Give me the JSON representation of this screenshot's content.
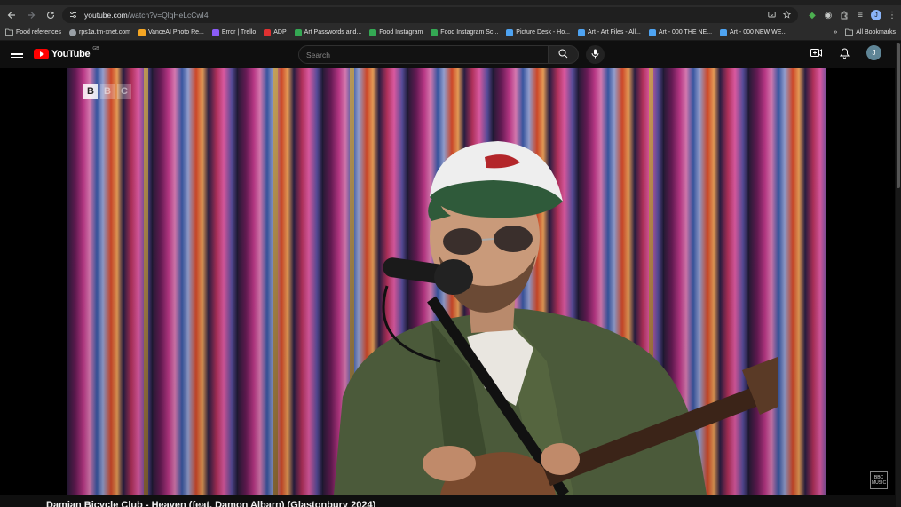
{
  "browser": {
    "url_host": "youtube.com",
    "url_path": "/watch?v=QlqHeLcCwI4",
    "bookmarks": [
      {
        "label": "Food references",
        "color": "#9aa0a6"
      },
      {
        "label": "rps1a.tm-xnet.com",
        "color": "#9aa0a6"
      },
      {
        "label": "VanceAI Photo Re...",
        "color": "#f5a623"
      },
      {
        "label": "Error | Trello",
        "color": "#8b5cf6"
      },
      {
        "label": "ADP",
        "color": "#e03131"
      },
      {
        "label": "Art Passwords and...",
        "color": "#34a853"
      },
      {
        "label": "Food Instagram",
        "color": "#34a853"
      },
      {
        "label": "Food Instagram Sc...",
        "color": "#34a853"
      },
      {
        "label": "Picture Desk - Ho...",
        "color": "#4ea3f1"
      },
      {
        "label": "Art - Art Files - All...",
        "color": "#4ea3f1"
      },
      {
        "label": "Art - 000 THE NE...",
        "color": "#4ea3f1"
      },
      {
        "label": "Art - 000 NEW WE...",
        "color": "#4ea3f1"
      }
    ],
    "bookmarks_overflow": "»",
    "all_bookmarks": "All Bookmarks",
    "profile_initial": "J"
  },
  "youtube": {
    "logo_text": "YouTube",
    "country_code": "GB",
    "search_placeholder": "Search",
    "avatar_initial": "J"
  },
  "video": {
    "watermark": [
      "B",
      "B",
      "C"
    ],
    "corner_badge_line1": "BBC",
    "corner_badge_line2": "MUSIC",
    "title": "Damian Bicycle Club - Heaven (feat. Damon Albarn) (Glastonbury 2024)"
  },
  "colors": {
    "youtube_red": "#ff0000",
    "page_bg": "#0f0f0f"
  }
}
